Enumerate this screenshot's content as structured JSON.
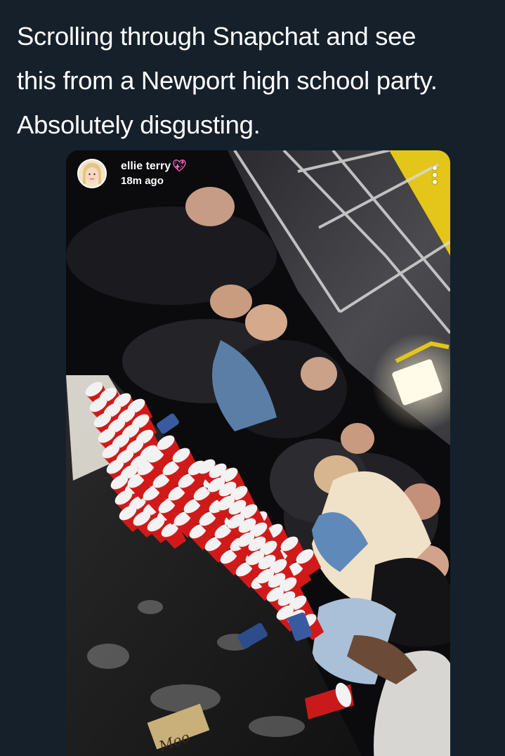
{
  "tweet": {
    "text_lines": [
      "Scrolling through Snapchat and see",
      "this from a Newport high school party.",
      "Absolutely disgusting."
    ]
  },
  "snap": {
    "username": "ellie terry",
    "username_emoji": "sparkling-heart-icon",
    "time_ago": "18m ago",
    "menu_icon": "vertical-dots-icon",
    "avatar_icon": "bitmoji-avatar-icon"
  },
  "colors": {
    "background": "#15202b",
    "text": "#ffffff",
    "cup_red": "#d01a1a",
    "accent_yellow": "#f2d21b",
    "heart": "#ff6ec7"
  }
}
